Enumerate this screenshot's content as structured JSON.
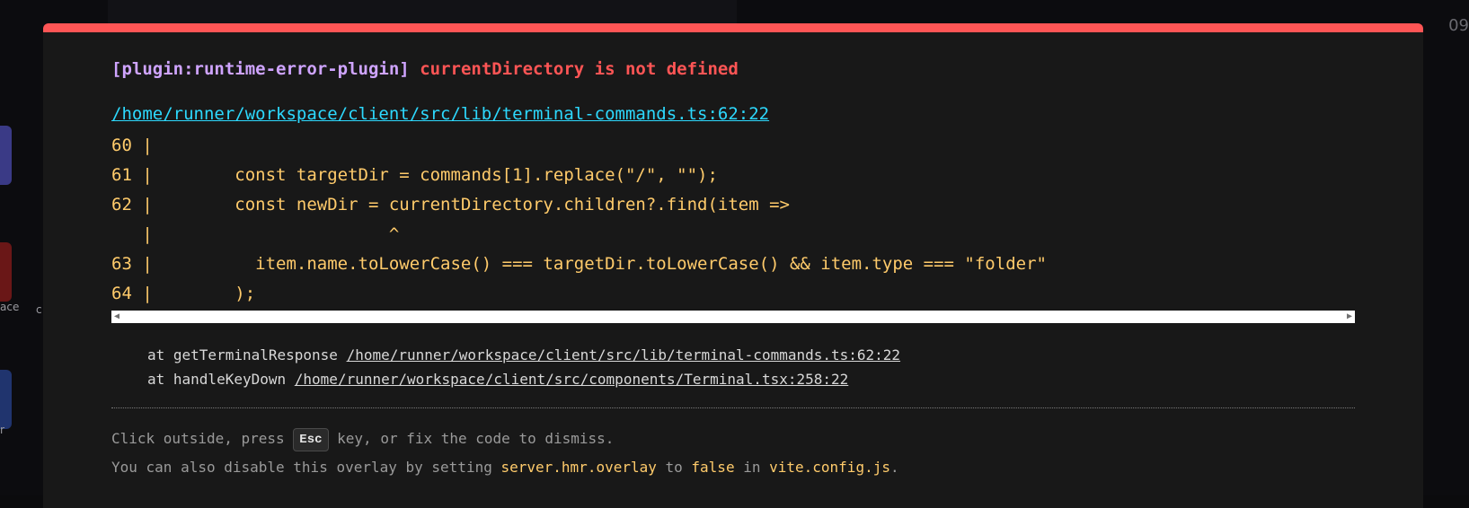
{
  "background": {
    "side_label_1": "ace",
    "side_label_2": "c",
    "side_label_3": "r",
    "clock_partial": "09"
  },
  "overlay": {
    "accent_color": "#ff5555",
    "plugin_tag": "[plugin:runtime-error-plugin]",
    "error_message": "currentDirectory is not defined",
    "file_location": "/home/runner/workspace/client/src/lib/terminal-commands.ts:62:22",
    "code_frame": [
      "60 |",
      "61 |        const targetDir = commands[1].replace(\"/\", \"\");",
      "62 |        const newDir = currentDirectory.children?.find(item =>",
      "   |                       ^",
      "63 |          item.name.toLowerCase() === targetDir.toLowerCase() && item.type === \"folder\"",
      "64 |        );"
    ],
    "stack": [
      {
        "prefix": "at getTerminalResponse ",
        "location": "/home/runner/workspace/client/src/lib/terminal-commands.ts:62:22"
      },
      {
        "prefix": "at handleKeyDown ",
        "location": "/home/runner/workspace/client/src/components/Terminal.tsx:258:22"
      }
    ],
    "tip": {
      "line1_before": "Click outside, press ",
      "esc_key": "Esc",
      "line1_after": " key, or fix the code to dismiss.",
      "line2_before": "You can also disable this overlay by setting ",
      "config_key": "server.hmr.overlay",
      "line2_mid": " to ",
      "config_value": "false",
      "line2_in": " in ",
      "config_file": "vite.config.js",
      "line2_end": "."
    }
  }
}
